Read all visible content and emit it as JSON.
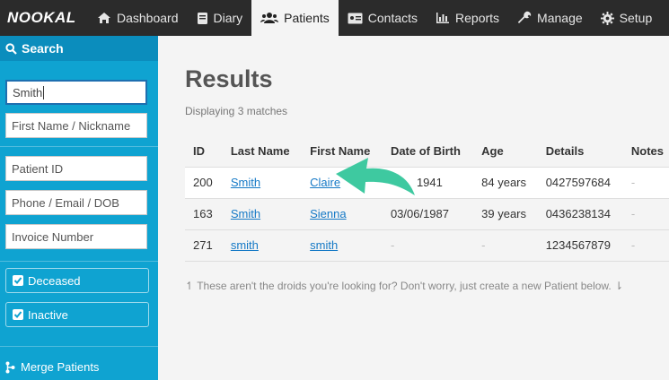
{
  "nav": {
    "logo": "NOOKAL",
    "items": [
      {
        "label": "Dashboard",
        "icon": "home-icon"
      },
      {
        "label": "Diary",
        "icon": "book-icon"
      },
      {
        "label": "Patients",
        "icon": "users-icon",
        "active": true
      },
      {
        "label": "Contacts",
        "icon": "id-card-icon"
      },
      {
        "label": "Reports",
        "icon": "bar-chart-icon"
      },
      {
        "label": "Manage",
        "icon": "wrench-icon"
      },
      {
        "label": "Setup",
        "icon": "gear-icon"
      }
    ]
  },
  "sidebar": {
    "header": "Search",
    "search_value": "Smith",
    "first_name_placeholder": "First Name / Nickname",
    "patient_id_placeholder": "Patient ID",
    "contact_placeholder": "Phone / Email / DOB",
    "invoice_placeholder": "Invoice Number",
    "deceased_label": "Deceased",
    "inactive_label": "Inactive",
    "merge_label": "Merge Patients"
  },
  "main": {
    "title": "Results",
    "subtitle": "Displaying 3 matches",
    "columns": [
      "ID",
      "Last Name",
      "First Name",
      "Date of Birth",
      "Age",
      "Details",
      "Notes"
    ],
    "rows": [
      {
        "id": "200",
        "last": "Smith",
        "first": "Claire",
        "dob": "1941",
        "age": "84 years",
        "details": "0427597684",
        "notes": "-"
      },
      {
        "id": "163",
        "last": "Smith",
        "first": "Sienna",
        "dob": "03/06/1987",
        "age": "39 years",
        "details": "0436238134",
        "notes": "-"
      },
      {
        "id": "271",
        "last": "smith",
        "first": "smith",
        "dob": "-",
        "age": "-",
        "details": "1234567879",
        "notes": "-"
      }
    ],
    "note": "These aren't the droids you're looking for? Don't worry, just create a new Patient below."
  },
  "colors": {
    "sidebar": "#0fa3d1",
    "nav": "#2b2b2b",
    "link": "#1579c6",
    "arrow": "#3ec9a0"
  }
}
